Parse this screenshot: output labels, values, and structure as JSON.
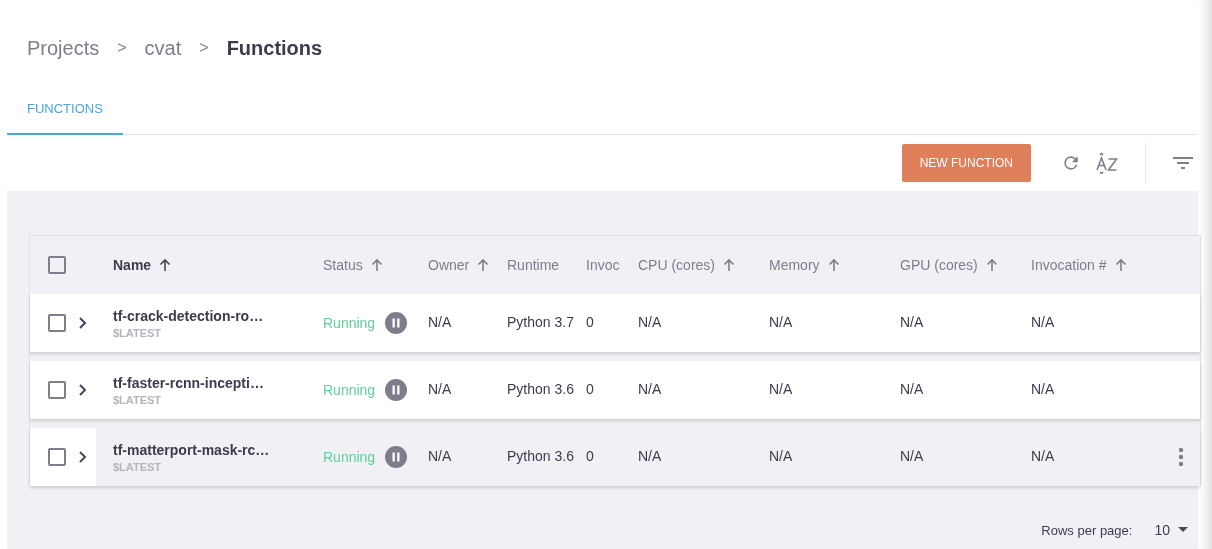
{
  "breadcrumbs": [
    {
      "label": "Projects",
      "current": false
    },
    {
      "label": "cvat",
      "current": false
    },
    {
      "label": "Functions",
      "current": true
    }
  ],
  "breadcrumb_separator": ">",
  "tabs": [
    {
      "label": "FUNCTIONS",
      "selected": true
    }
  ],
  "toolbar": {
    "new_button": "NEW FUNCTION"
  },
  "table": {
    "select_all_checked": false,
    "columns": [
      {
        "label": "Name",
        "sortable": true,
        "active": true
      },
      {
        "label": "Status",
        "sortable": true,
        "active": false
      },
      {
        "label": "Owner",
        "sortable": true,
        "active": false
      },
      {
        "label": "Runtime",
        "sortable": false,
        "active": false
      },
      {
        "label": "Invoc",
        "sortable": false,
        "active": false
      },
      {
        "label": "CPU (cores)",
        "sortable": true,
        "active": false
      },
      {
        "label": "Memory",
        "sortable": true,
        "active": false
      },
      {
        "label": "GPU (cores)",
        "sortable": true,
        "active": false
      },
      {
        "label": "Invocation #",
        "sortable": true,
        "active": false
      }
    ],
    "rows": [
      {
        "checked": false,
        "hovered": false,
        "name": "tf-crack-detection-ro…",
        "tag": "$LATEST",
        "status": "Running",
        "owner": "N/A",
        "runtime": "Python 3.7",
        "invoc": "0",
        "cpu": "N/A",
        "memory": "N/A",
        "gpu": "N/A",
        "invocation": "N/A"
      },
      {
        "checked": false,
        "hovered": false,
        "name": "tf-faster-rcnn-incepti…",
        "tag": "$LATEST",
        "status": "Running",
        "owner": "N/A",
        "runtime": "Python 3.6",
        "invoc": "0",
        "cpu": "N/A",
        "memory": "N/A",
        "gpu": "N/A",
        "invocation": "N/A"
      },
      {
        "checked": false,
        "hovered": true,
        "name": "tf-matterport-mask-rc…",
        "tag": "$LATEST",
        "status": "Running",
        "owner": "N/A",
        "runtime": "Python 3.6",
        "invoc": "0",
        "cpu": "N/A",
        "memory": "N/A",
        "gpu": "N/A",
        "invocation": "N/A"
      }
    ]
  },
  "pagination": {
    "label": "Rows per page:",
    "value": "10"
  }
}
